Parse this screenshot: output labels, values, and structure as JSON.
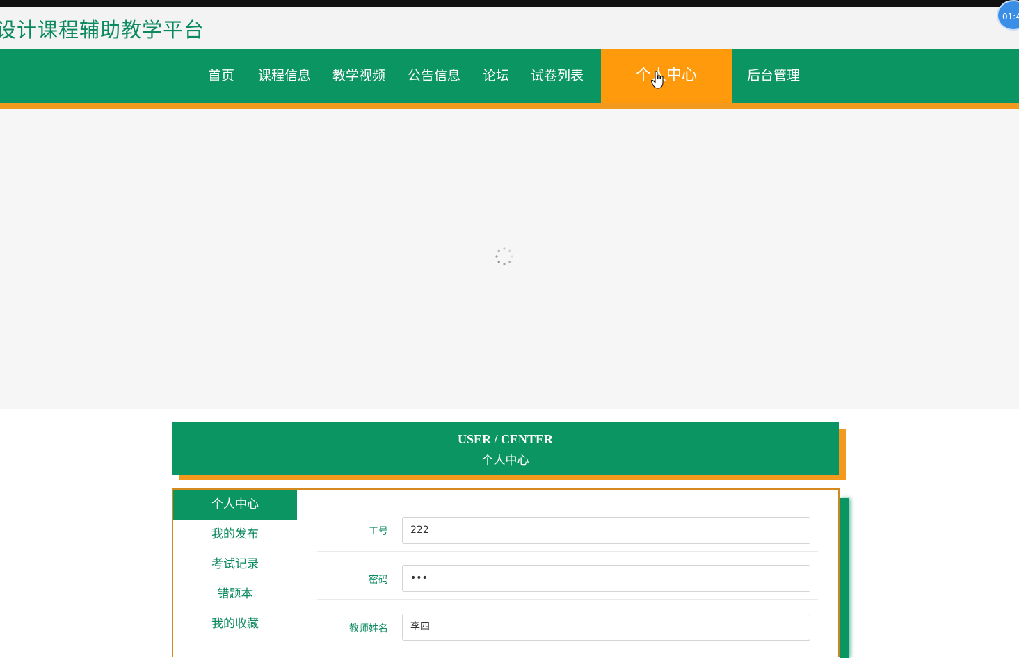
{
  "site": {
    "title": "设计课程辅助教学平台",
    "timer": "01:4"
  },
  "nav": {
    "items": [
      {
        "label": "首页"
      },
      {
        "label": "课程信息"
      },
      {
        "label": "教学视频"
      },
      {
        "label": "公告信息"
      },
      {
        "label": "论坛"
      },
      {
        "label": "试卷列表"
      },
      {
        "label": "个人中心",
        "active": true
      },
      {
        "label": "后台管理"
      }
    ]
  },
  "user_center": {
    "title_en": "USER / CENTER",
    "title_cn": "个人中心"
  },
  "sidebar": {
    "items": [
      {
        "label": "个人中心",
        "active": true
      },
      {
        "label": "我的发布"
      },
      {
        "label": "考试记录"
      },
      {
        "label": "错题本"
      },
      {
        "label": "我的收藏"
      }
    ]
  },
  "form": {
    "fields": [
      {
        "label": "工号",
        "value": "222"
      },
      {
        "label": "密码",
        "value": "•••"
      },
      {
        "label": "教师姓名",
        "value": "李四"
      }
    ]
  },
  "colors": {
    "primary": "#0b9563",
    "accent": "#ff9a0d",
    "stripe": "#f39a1e"
  }
}
